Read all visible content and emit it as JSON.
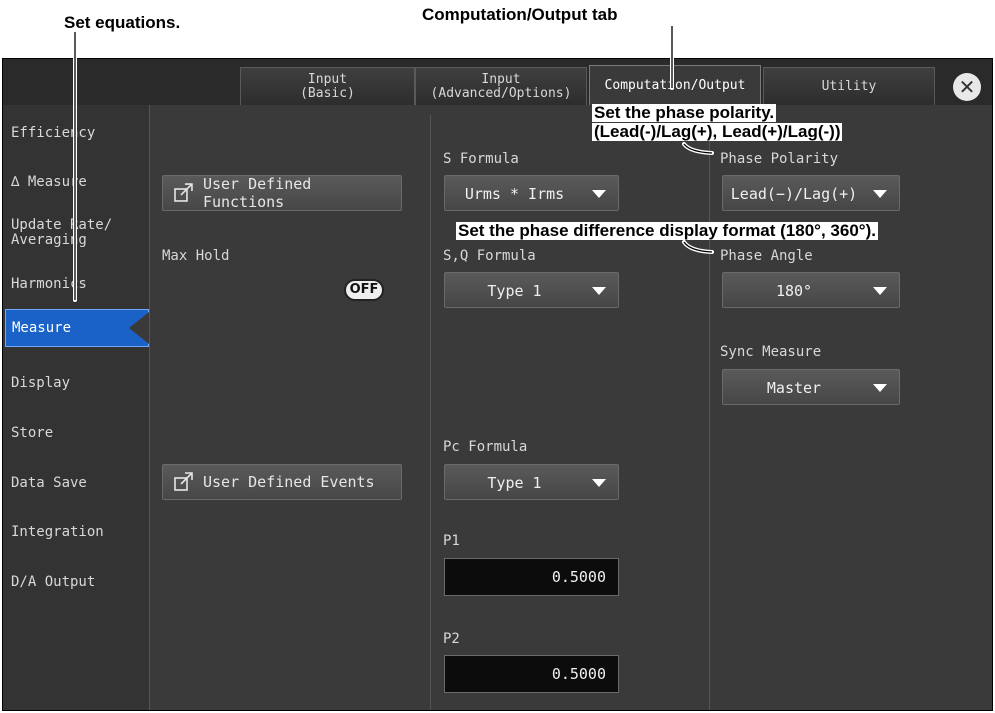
{
  "annotations": {
    "set_equations": "Set equations.",
    "tab_caption": "Computation/Output tab",
    "phase_polarity_line1": "Set the phase polarity.",
    "phase_polarity_line2": "(Lead(-)/Lag(+), Lead(+)/Lag(-))",
    "phase_angle_note": "Set the phase difference display format (180°, 360°)."
  },
  "tabs": [
    {
      "label": "Input\n(Basic)"
    },
    {
      "label": "Input\n(Advanced/Options)"
    },
    {
      "label": "Computation/Output"
    },
    {
      "label": "Utility"
    }
  ],
  "close_glyph": "✕",
  "sidebar": {
    "items": [
      "Efficiency",
      "∆ Measure",
      "Update Rate/\nAveraging",
      "Harmonics",
      "Measure",
      "Display",
      "Store",
      "Data Save",
      "Integration",
      "D/A Output"
    ],
    "active_index": 4
  },
  "main": {
    "user_defined_functions": "User Defined Functions",
    "max_hold_label": "Max Hold",
    "max_hold_state": "OFF",
    "user_defined_events": "User Defined Events",
    "s_formula_label": "S Formula",
    "s_formula_value": "Urms * Irms",
    "sq_formula_label": "S,Q Formula",
    "sq_formula_value": "Type 1",
    "pc_formula_label": "Pc Formula",
    "pc_formula_value": "Type 1",
    "p1_label": "P1",
    "p1_value": "0.5000",
    "p2_label": "P2",
    "p2_value": "0.5000",
    "phase_polarity_label": "Phase Polarity",
    "phase_polarity_value": "Lead(−)/Lag(+)",
    "phase_angle_label": "Phase Angle",
    "phase_angle_value": "180°",
    "sync_measure_label": "Sync Measure",
    "sync_measure_value": "Master"
  },
  "colors": {
    "accent": "#1a62c8",
    "panel": "#3a3a3a"
  }
}
